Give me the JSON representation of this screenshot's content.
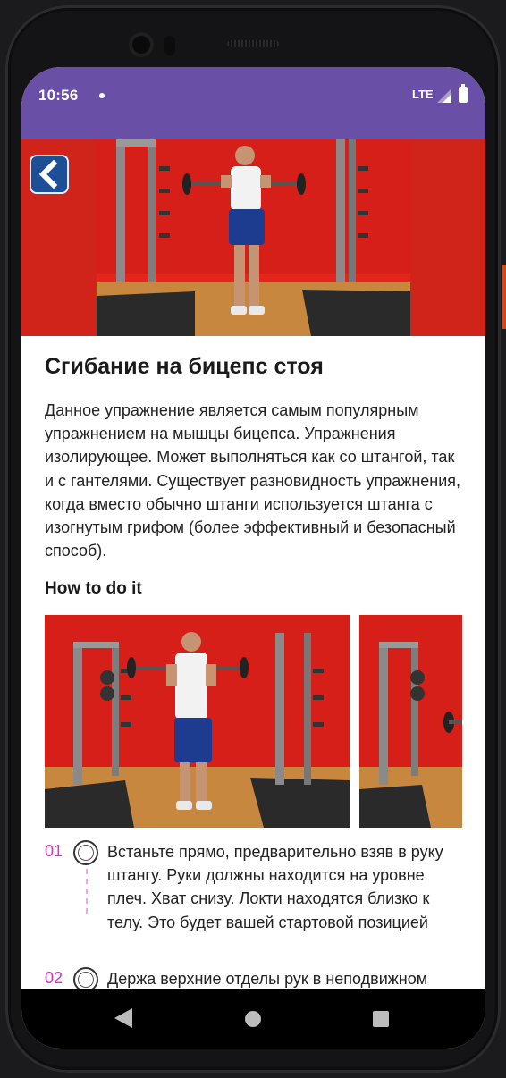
{
  "status_bar": {
    "time": "10:56",
    "network": "LTE"
  },
  "exercise": {
    "title": "Сгибание на бицепс стоя",
    "description": "Данное упражнение является самым популярным упражнением на мышцы бицепса. Упражнения изолирующее. Может выполняться как со штангой, так и с гантелями. Существует разновидность упражнения, когда вместо обычно штанги используется штанга с изогнутым грифом (более эффективный и безопасный способ).",
    "section_heading": "How to do it"
  },
  "steps": [
    {
      "number": "01",
      "text": "Встаньте прямо, предварительно взяв в руку штангу. Руки должны находится на уровне плеч. Хват снизу. Локти находятся близко к телу. Это будет вашей стартовой позицией"
    },
    {
      "number": "02",
      "text": "Держа верхние отделы рук в неподвижном"
    }
  ],
  "icons": {
    "back": "chevron-left-icon",
    "signal": "signal-icon",
    "battery": "battery-icon",
    "nav_back": "triangle-back-icon",
    "nav_home": "circle-home-icon",
    "nav_recents": "square-recents-icon"
  },
  "colors": {
    "status_bar": "#6a4fa6",
    "hero_background": "#d0241a",
    "step_number": "#d530c6",
    "back_button": "#1d4f99"
  }
}
